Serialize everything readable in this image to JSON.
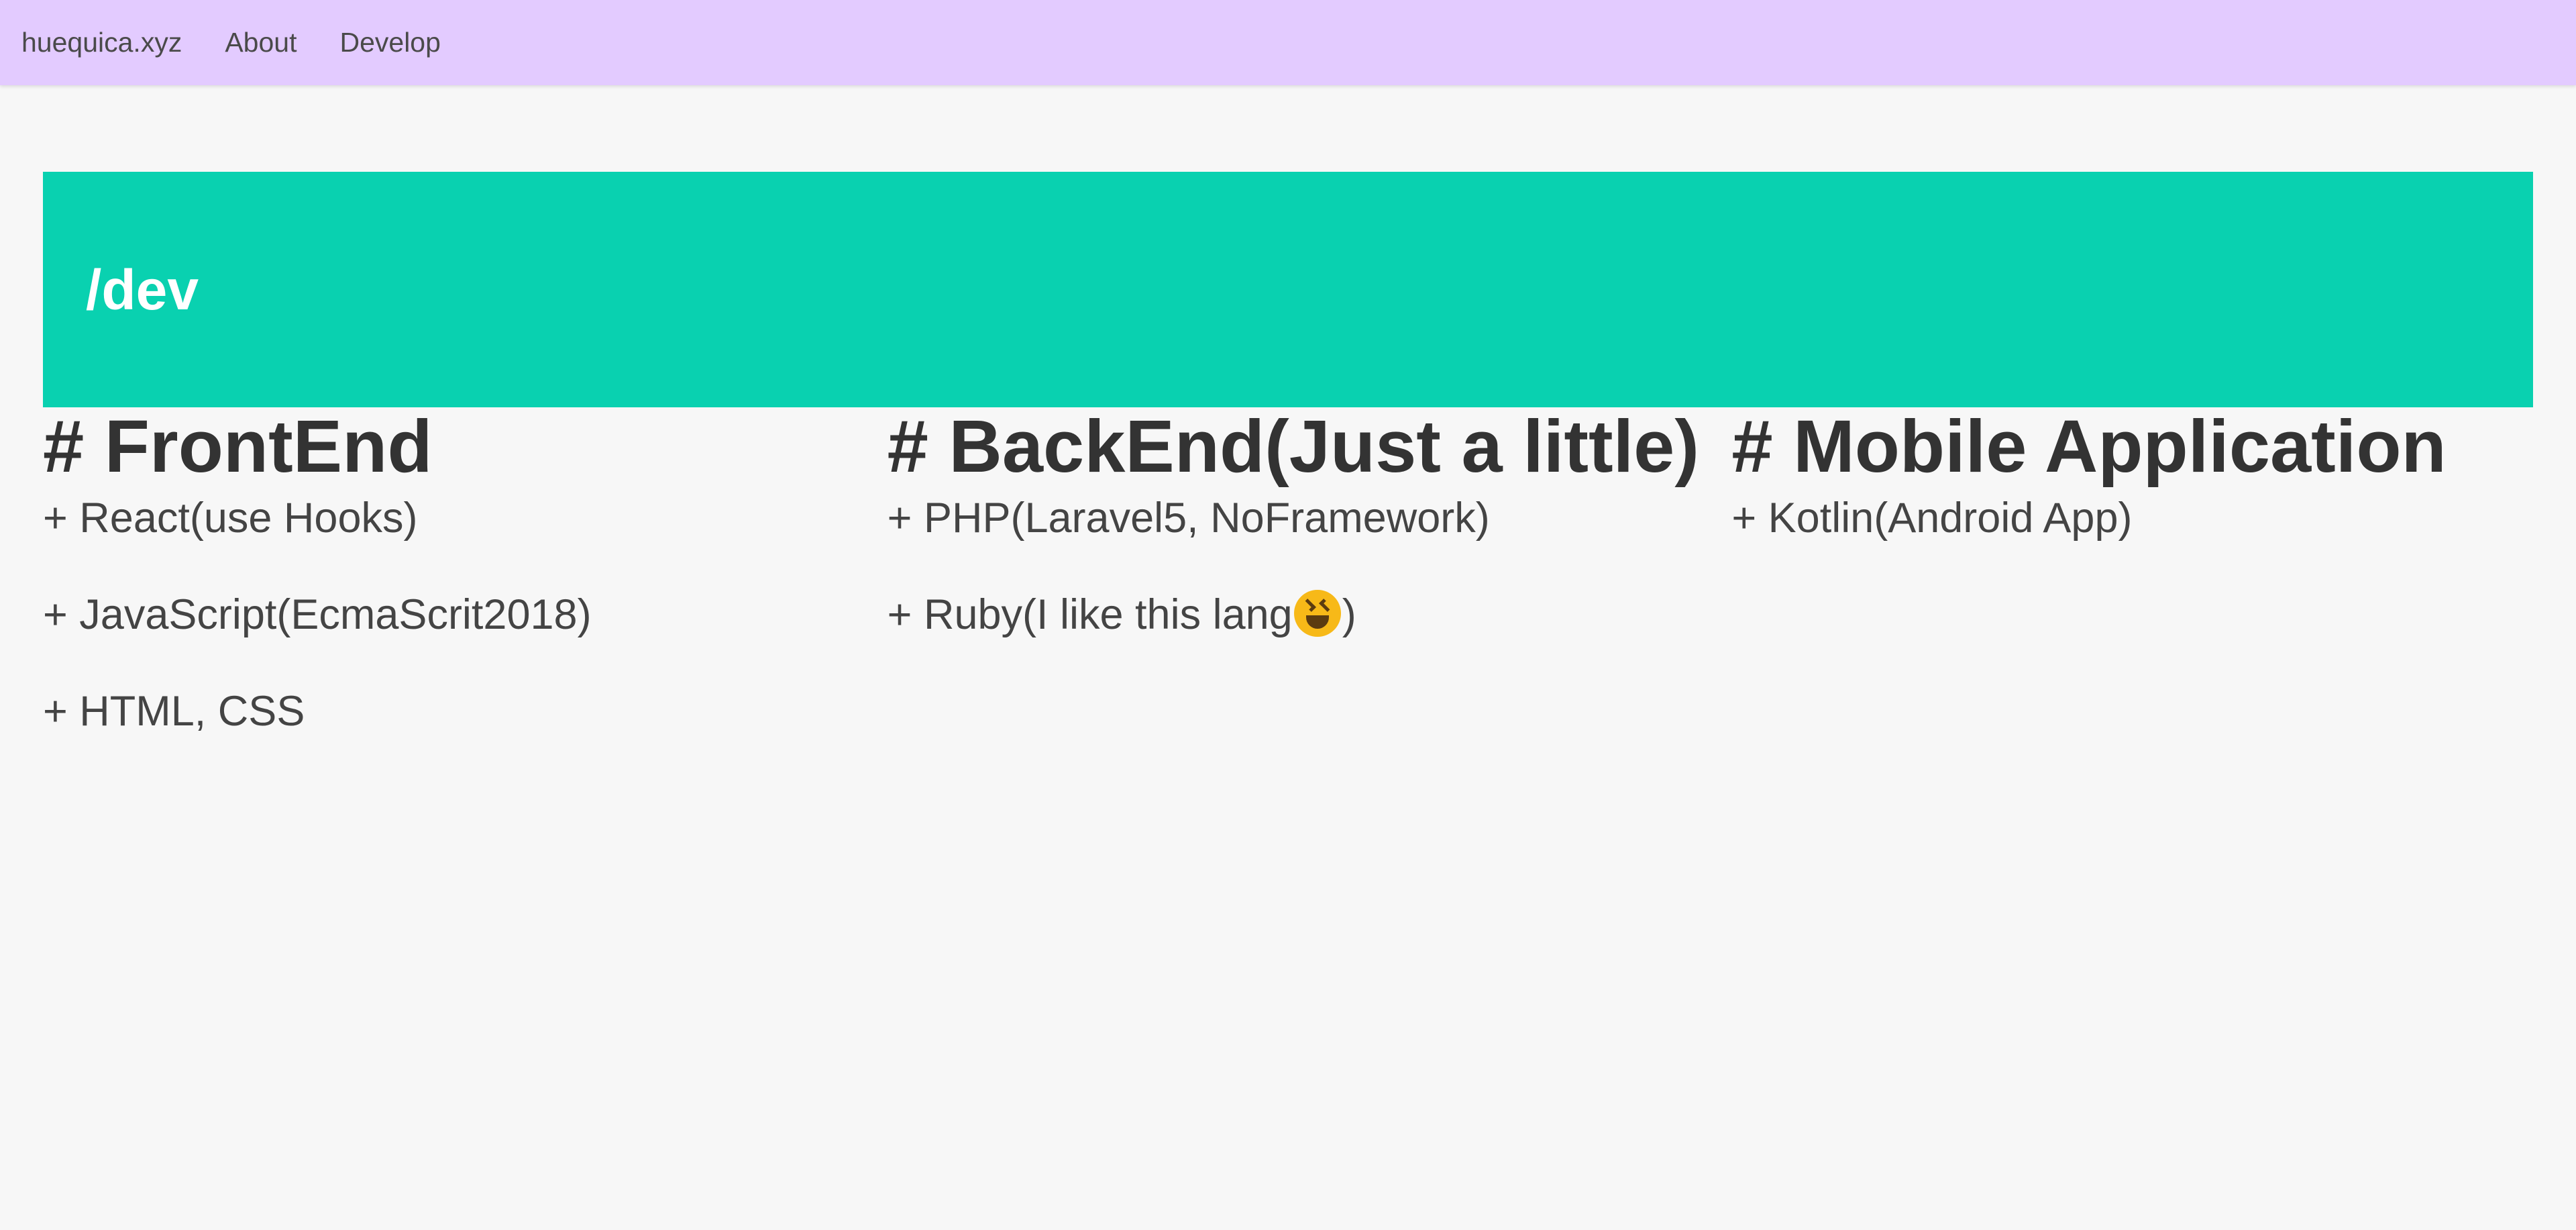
{
  "nav": {
    "brand": "huequica.xyz",
    "links": [
      "About",
      "Develop"
    ]
  },
  "hero": {
    "title": "/dev",
    "background": "#09d1b0"
  },
  "sections": [
    {
      "heading": "# FrontEnd",
      "items": [
        "+ React(use Hooks)",
        "+ JavaScript(EcmaScrit2018)",
        "+ HTML, CSS"
      ]
    },
    {
      "heading": "# BackEnd(Just a little)",
      "items": [
        "+ PHP(Laravel5, NoFramework)",
        "+ Ruby(I like this lang",
        ")"
      ]
    },
    {
      "heading": "# Mobile Application",
      "items": [
        "+ Kotlin(Android App)"
      ]
    }
  ],
  "emoji_icon": "grinning-squinting-face",
  "colors": {
    "navbar": "#e3cbff",
    "background": "#f7f7f7",
    "text": "#333333"
  }
}
